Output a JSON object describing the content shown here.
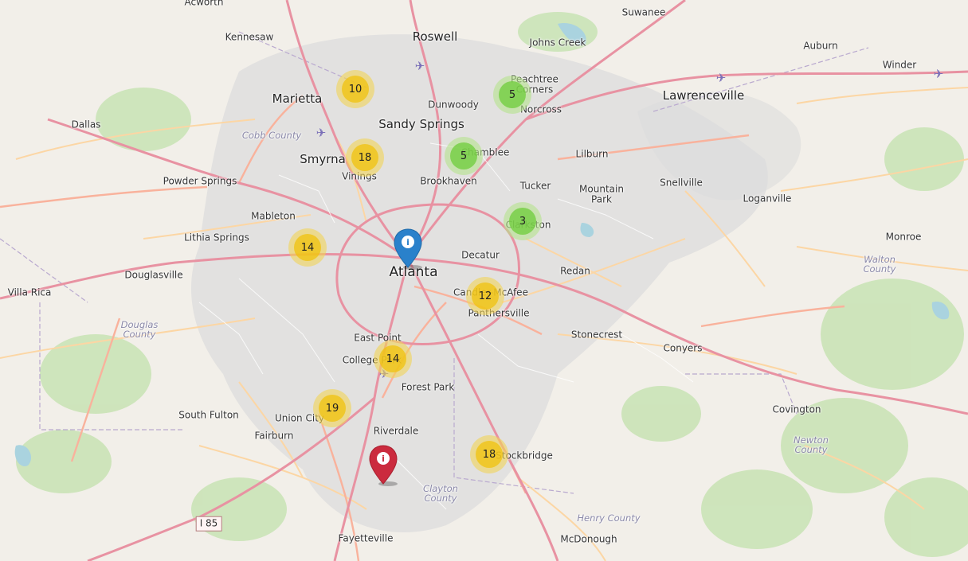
{
  "map": {
    "colors": {
      "land": "#f2efe9",
      "urban": "#dddddd",
      "forest": "#c8e3b4",
      "water": "#aad3df",
      "motorway": "#e892a2",
      "trunk": "#f9b29c",
      "primary": "#fcd6a4",
      "blue_marker": "#2a81cb",
      "red_marker": "#cb2b3e"
    },
    "labels": {
      "acworth": "Acworth",
      "kennesaw": "Kennesaw",
      "roswell": "Roswell",
      "suwanee": "Suwanee",
      "johns_creek": "Johns Creek",
      "auburn": "Auburn",
      "winder": "Winder",
      "peachtree_corners": "Peachtree\nCorners",
      "marietta": "Marietta",
      "dunwoody": "Dunwoody",
      "norcross": "Norcross",
      "lawrenceville": "Lawrenceville",
      "dallas": "Dallas",
      "sandy_springs": "Sandy Springs",
      "cobb_county": "Cobb County",
      "smyrna": "Smyrna",
      "vinings": "Vinings",
      "chamblee": "Chamblee",
      "lilburn": "Lilburn",
      "powder_springs": "Powder Springs",
      "brookhaven": "Brookhaven",
      "tucker": "Tucker",
      "mountain_park": "Mountain\nPark",
      "snellville": "Snellville",
      "loganville": "Loganville",
      "mableton": "Mableton",
      "clarkston": "Clarkston",
      "lithia_springs": "Lithia Springs",
      "monroe": "Monroe",
      "walton_county": "Walton\nCounty",
      "decatur": "Decatur",
      "douglasville": "Douglasville",
      "atlanta": "Atlanta",
      "redan": "Redan",
      "villa_rica": "Villa Rica",
      "candler_mcafee": "Candler-McAfee",
      "panthersville": "Panthersville",
      "douglas_county": "Douglas\nCounty",
      "stonecrest": "Stonecrest",
      "east_point": "East Point",
      "conyers": "Conyers",
      "college_park": "College Park",
      "forest_park": "Forest Park",
      "south_fulton": "South Fulton",
      "union_city": "Union City",
      "covington": "Covington",
      "riverdale": "Riverdale",
      "fairburn": "Fairburn",
      "newton_county": "Newton\nCounty",
      "stockbridge": "Stockbridge",
      "clayton_county": "Clayton\nCounty",
      "i85": "I 85",
      "henry_county": "Henry County",
      "fayetteville": "Fayetteville",
      "mcdonough": "McDonough"
    },
    "clusters": {
      "marietta_n": "10",
      "smyrna": "18",
      "mableton": "14",
      "peachtree_corners": "5",
      "chamblee": "5",
      "clarkston": "3",
      "candler": "12",
      "college_park": "14",
      "union_city": "19",
      "stockbridge": "18"
    },
    "cluster_colors": {
      "marietta_n": "yellow",
      "smyrna": "yellow",
      "mableton": "yellow",
      "peachtree_corners": "green",
      "chamblee": "green",
      "clarkston": "green",
      "candler": "yellow",
      "college_park": "yellow",
      "union_city": "yellow",
      "stockbridge": "yellow"
    },
    "markers": {
      "atlanta": {
        "color": "blue",
        "icon": "info-icon"
      },
      "riverdale_south": {
        "color": "red",
        "icon": "info-icon"
      }
    },
    "airports": [
      "airplane-icon",
      "airplane-icon",
      "airplane-icon",
      "airplane-icon",
      "airplane-icon"
    ]
  }
}
